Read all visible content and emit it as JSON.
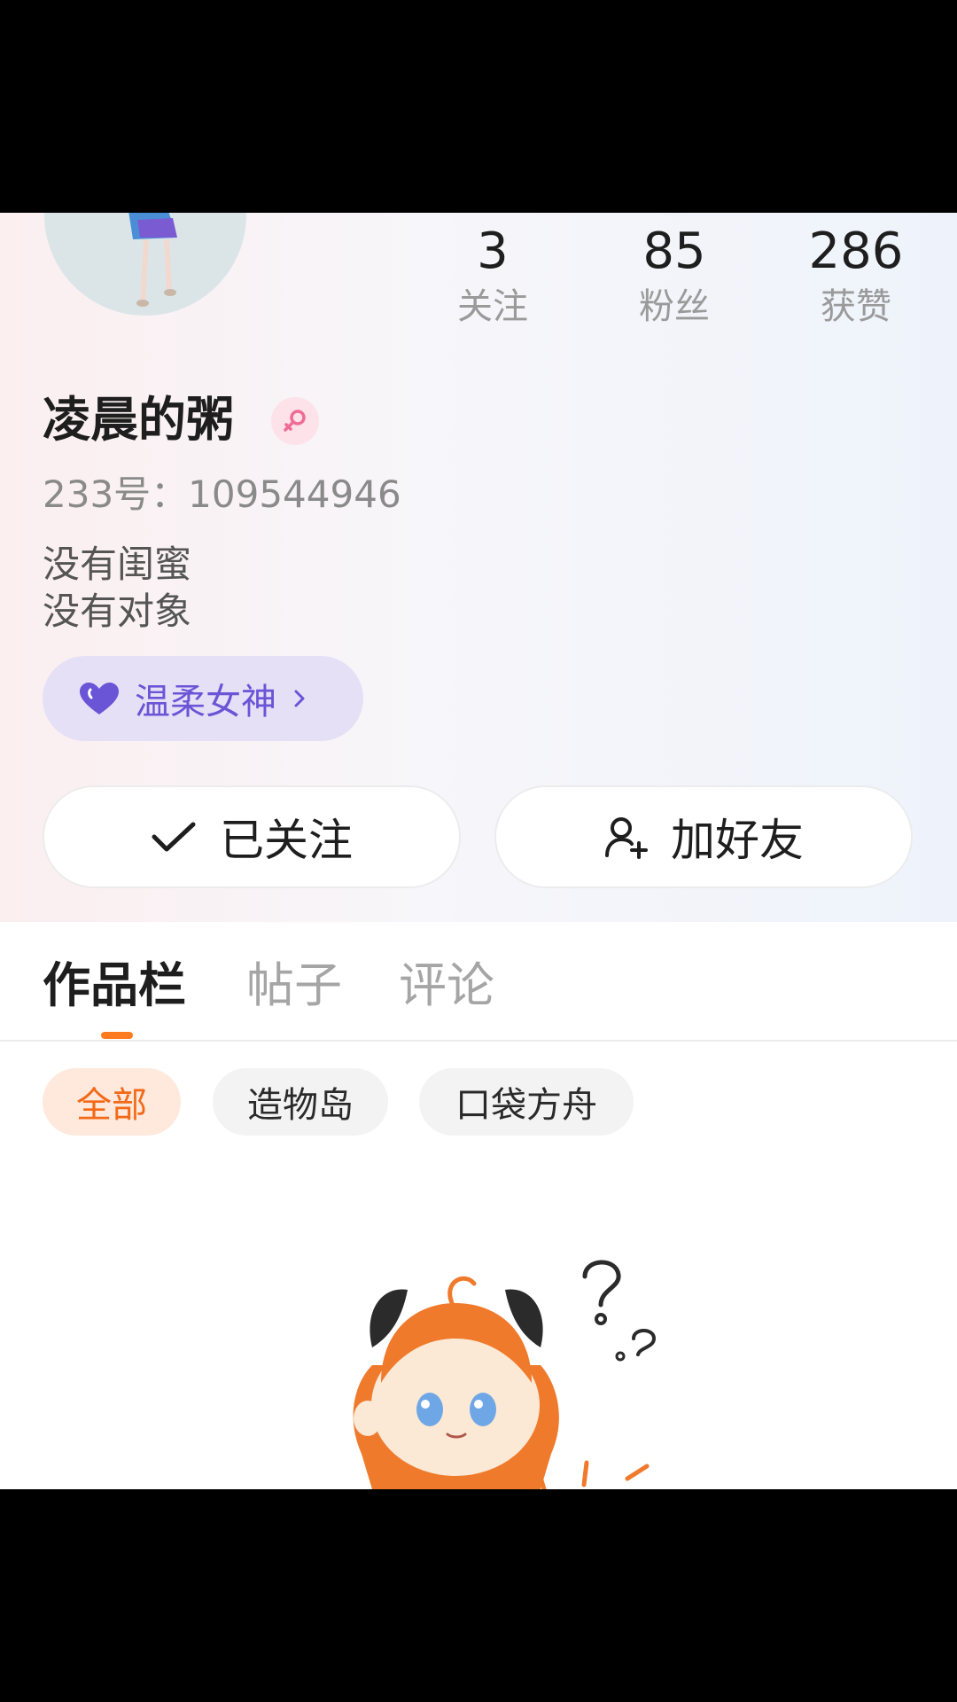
{
  "stats": [
    {
      "value": "3",
      "label": "关注"
    },
    {
      "value": "85",
      "label": "粉丝"
    },
    {
      "value": "286",
      "label": "获赞"
    }
  ],
  "profile": {
    "username": "凌晨的粥",
    "gender_icon": "female-icon",
    "uid": "233号：109544946",
    "bio_line1": "没有闺蜜",
    "bio_line2": "没有对象",
    "title_tag": "温柔女神"
  },
  "actions": {
    "follow_label": "已关注",
    "add_friend_label": "加好友"
  },
  "tabs": [
    {
      "label": "作品栏",
      "active": true
    },
    {
      "label": "帖子",
      "active": false
    },
    {
      "label": "评论",
      "active": false
    }
  ],
  "filters": [
    {
      "label": "全部",
      "active": true
    },
    {
      "label": "造物岛",
      "active": false
    },
    {
      "label": "口袋方舟",
      "active": false
    }
  ],
  "colors": {
    "accent": "#ff7a1f",
    "tag_purple": "#6a55d6",
    "gender_pink": "#f06c94"
  }
}
